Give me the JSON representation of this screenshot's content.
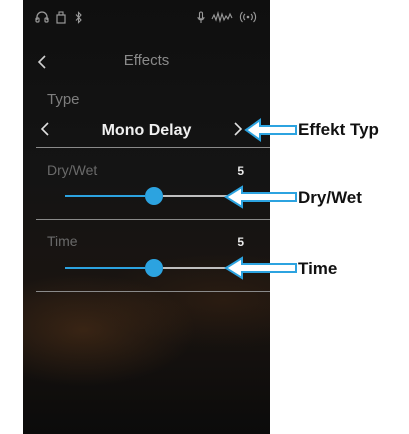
{
  "header": {
    "title": "Effects"
  },
  "status_icons": [
    "headphones-icon",
    "usb-icon",
    "bluetooth-icon",
    "microphone-icon",
    "audio-recorder-icon",
    "wireless-icon"
  ],
  "type": {
    "label": "Type",
    "value": "Mono Delay"
  },
  "params": [
    {
      "label": "Dry/Wet",
      "value": "5",
      "level": 0.5
    },
    {
      "label": "Time",
      "value": "5",
      "level": 0.5
    }
  ],
  "annotations": {
    "effect_type": "Effekt Typ",
    "dry_wet": "Dry/Wet",
    "time": "Time"
  },
  "colors": {
    "accent": "#2ca3e0",
    "background": "#141414",
    "annotation_arrow": "#2ca3e0"
  }
}
